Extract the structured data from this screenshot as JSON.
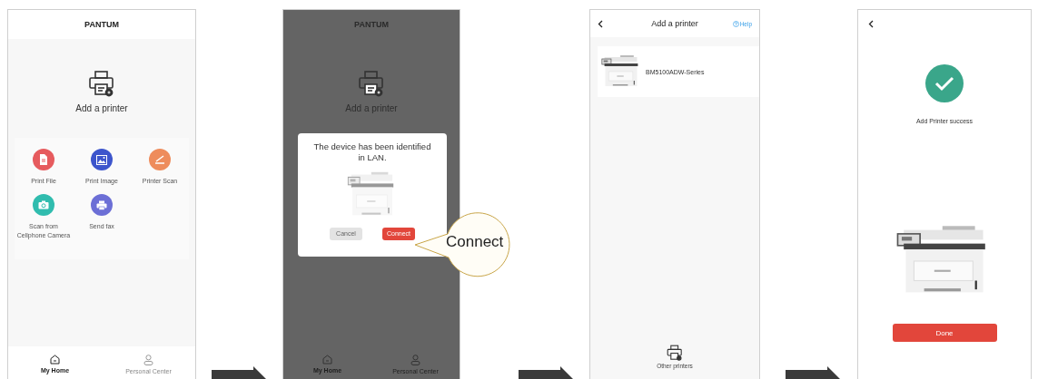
{
  "screens": [
    {
      "kind": "home",
      "dimmed": false,
      "title": "PANTUM",
      "add_label": "Add a printer",
      "functions": [
        {
          "label": "Print File",
          "color": "#e65b5e"
        },
        {
          "label": "Print Image",
          "color": "#3d55cc"
        },
        {
          "label": "Printer Scan",
          "color": "#ee8c5c"
        },
        {
          "label": "Scan from Cellphone Camera",
          "color": "#30bcae"
        },
        {
          "label": "Send fax",
          "color": "#6c6fd6"
        }
      ],
      "nav": [
        {
          "label": "My Home",
          "selected": true
        },
        {
          "label": "Personal Center",
          "selected": false
        }
      ]
    },
    {
      "kind": "home",
      "dimmed": true,
      "title": "PANTUM",
      "add_label": "Add a printer",
      "nav": [
        {
          "label": "My Home",
          "selected": true
        },
        {
          "label": "Personal Center",
          "selected": false
        }
      ],
      "dialog": {
        "message": "The device has been identified in LAN.",
        "buttons": [
          {
            "label": "Cancel",
            "kind": "secondary"
          },
          {
            "label": "Connect",
            "kind": "primary"
          }
        ]
      },
      "callout": "Connect"
    },
    {
      "kind": "device_list",
      "title": "Add a printer",
      "help": "Help",
      "devices": [
        {
          "name": "BM5100ADW-Series"
        }
      ],
      "other": "Other printers"
    },
    {
      "kind": "success",
      "message": "Add Printer success",
      "button": "Done"
    }
  ]
}
